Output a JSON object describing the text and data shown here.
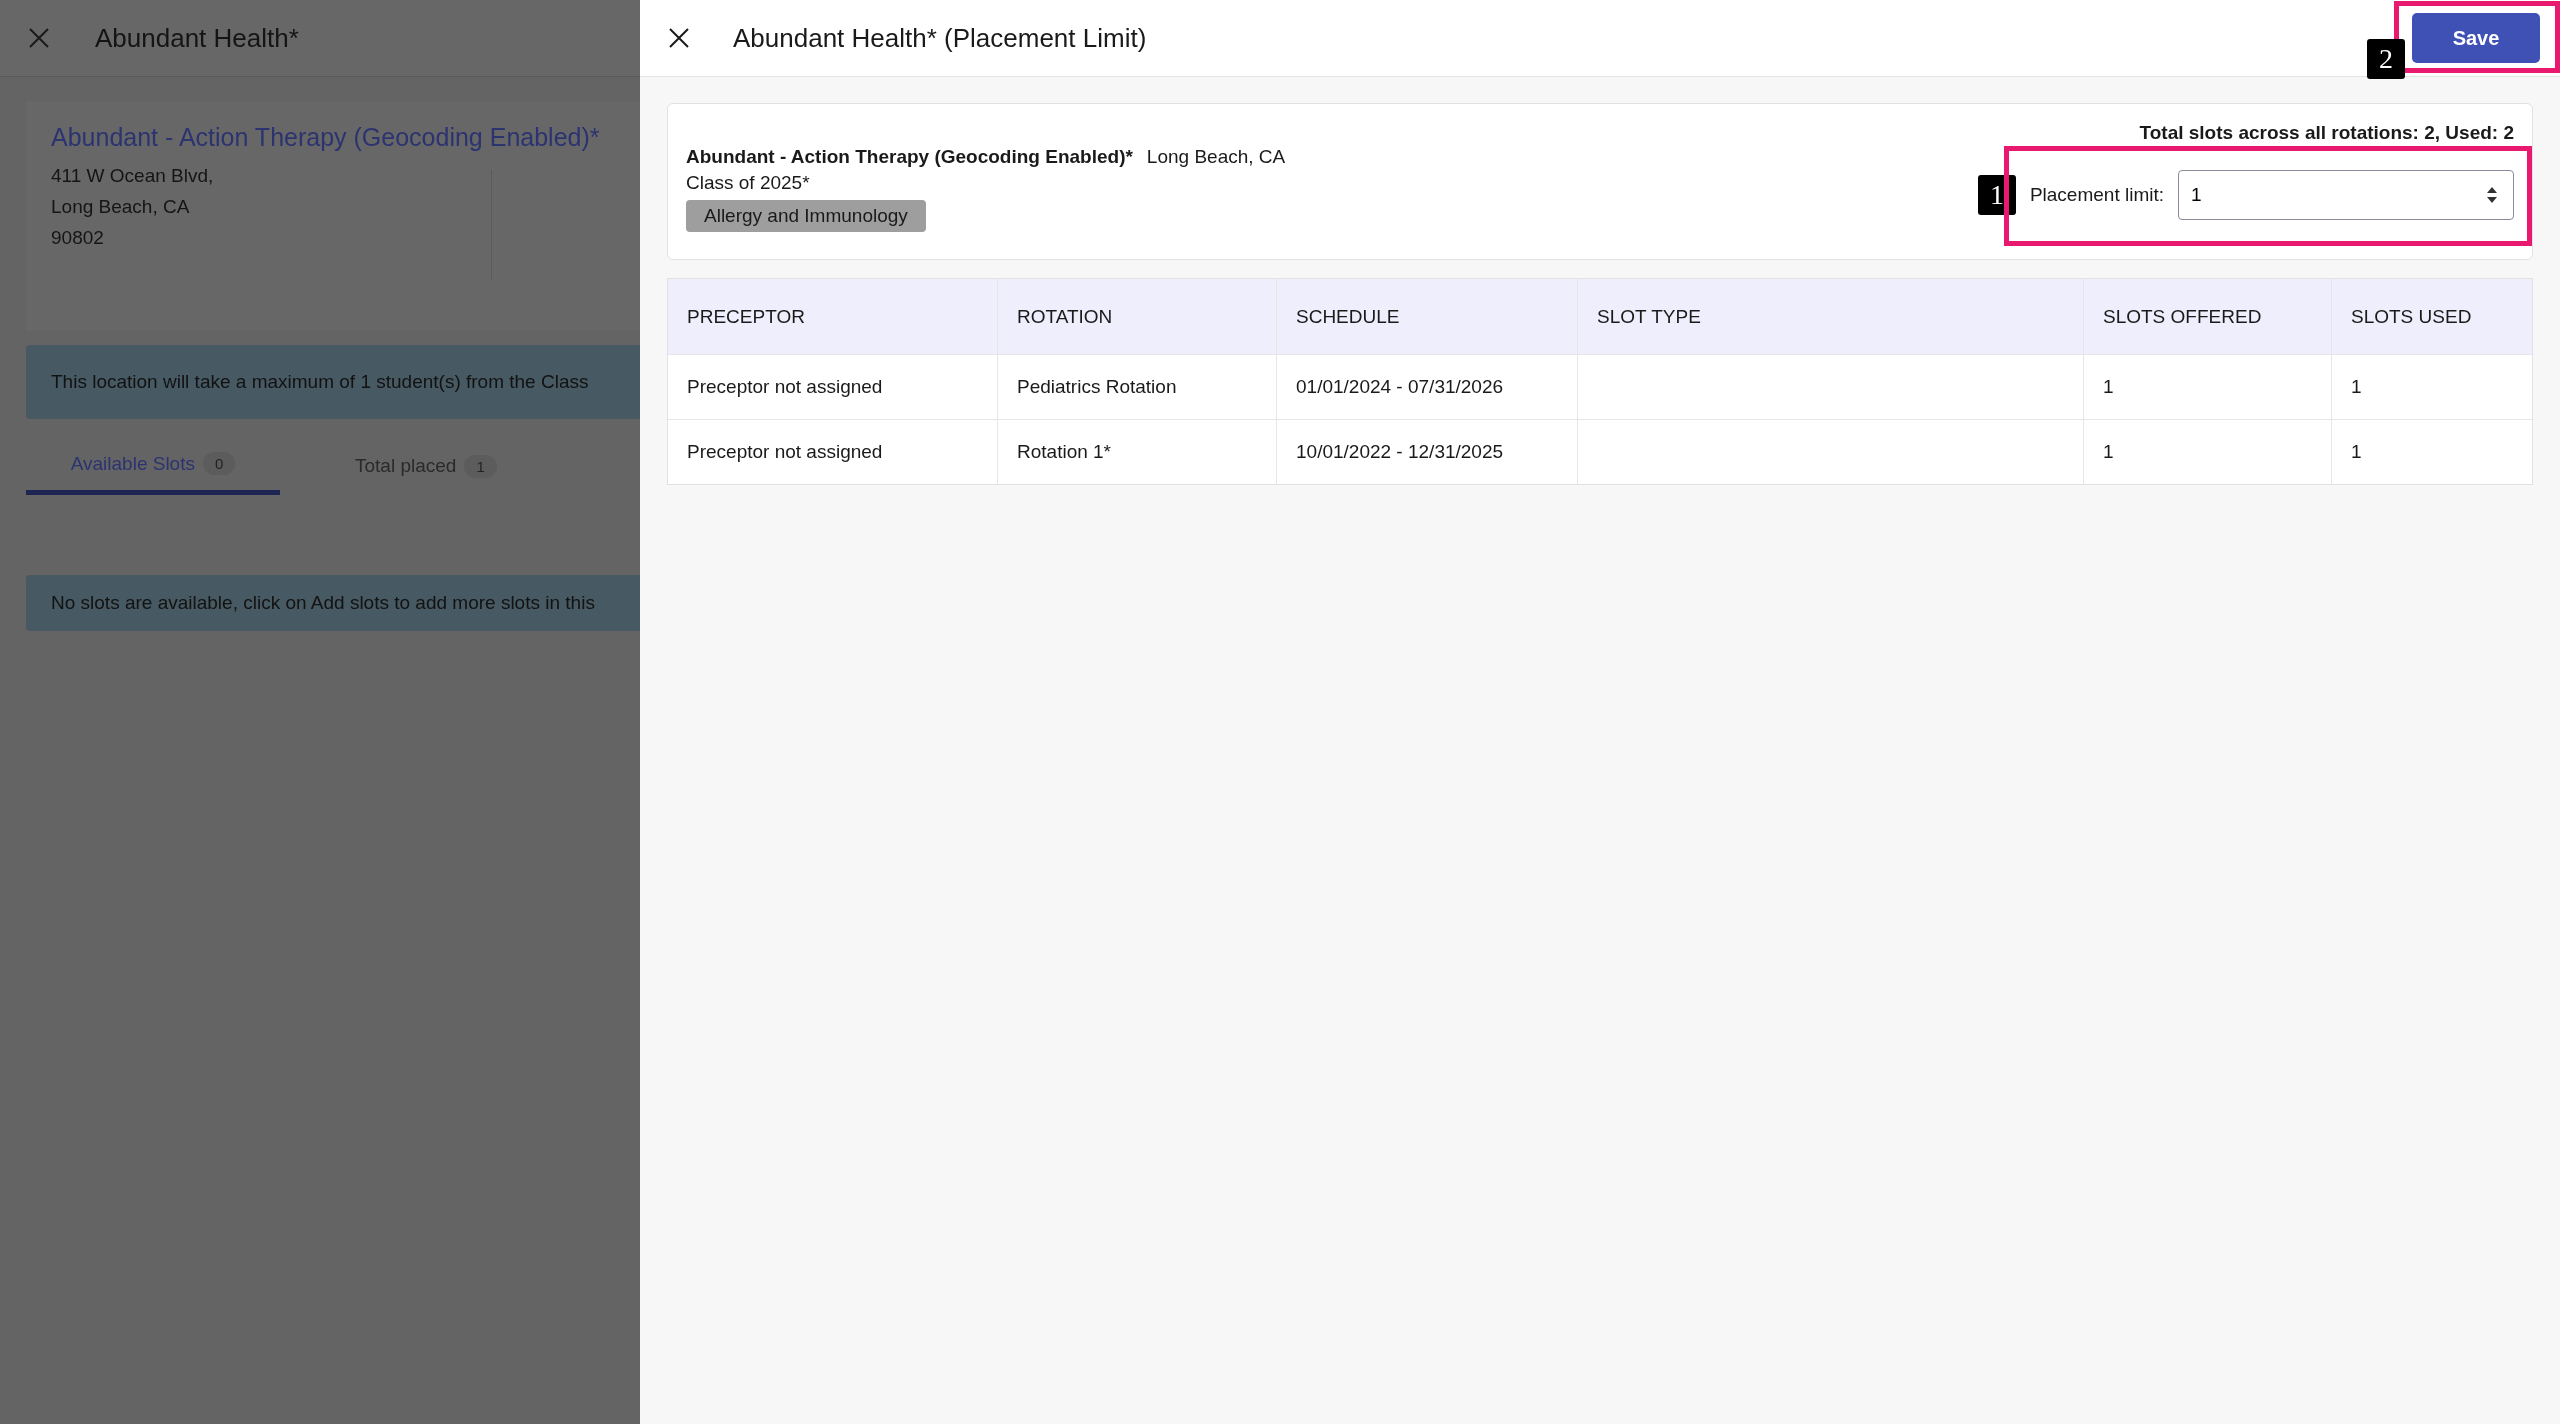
{
  "background_panel": {
    "title": "Abundant Health*",
    "location_name": "Abundant - Action Therapy (Geocoding Enabled)*",
    "address_lines": [
      "411 W Ocean Blvd,",
      "Long Beach, CA",
      "90802"
    ],
    "notice": "This location will take a maximum of 1 student(s) from the Class",
    "tabs": [
      {
        "label": "Available Slots",
        "count": "0",
        "selected": true
      },
      {
        "label": "Total placed",
        "count": "1",
        "selected": false
      }
    ],
    "empty_message": "No slots are available, click on Add slots to add more slots in this"
  },
  "drawer": {
    "title": "Abundant Health* (Placement Limit)",
    "save_button": "Save",
    "location": {
      "name": "Abundant - Action Therapy (Geocoding Enabled)*",
      "city": "Long Beach, CA",
      "class": "Class of 2025*",
      "tag": "Allergy and Immunology"
    },
    "totals": "Total slots across all rotations: 2, Used: 2",
    "placement_limit": {
      "label": "Placement limit:",
      "value": "1"
    }
  },
  "table": {
    "columns": [
      "PRECEPTOR",
      "ROTATION",
      "SCHEDULE",
      "SLOT TYPE",
      "SLOTS OFFERED",
      "SLOTS USED"
    ],
    "rows": [
      [
        "Preceptor not assigned",
        "Pediatrics Rotation",
        "01/01/2024 - 07/31/2026",
        "",
        "1",
        "1"
      ],
      [
        "Preceptor not assigned",
        "Rotation 1*",
        "10/01/2022 - 12/31/2025",
        "",
        "1",
        "1"
      ]
    ]
  },
  "callouts": [
    {
      "number": "1"
    },
    {
      "number": "2"
    }
  ]
}
